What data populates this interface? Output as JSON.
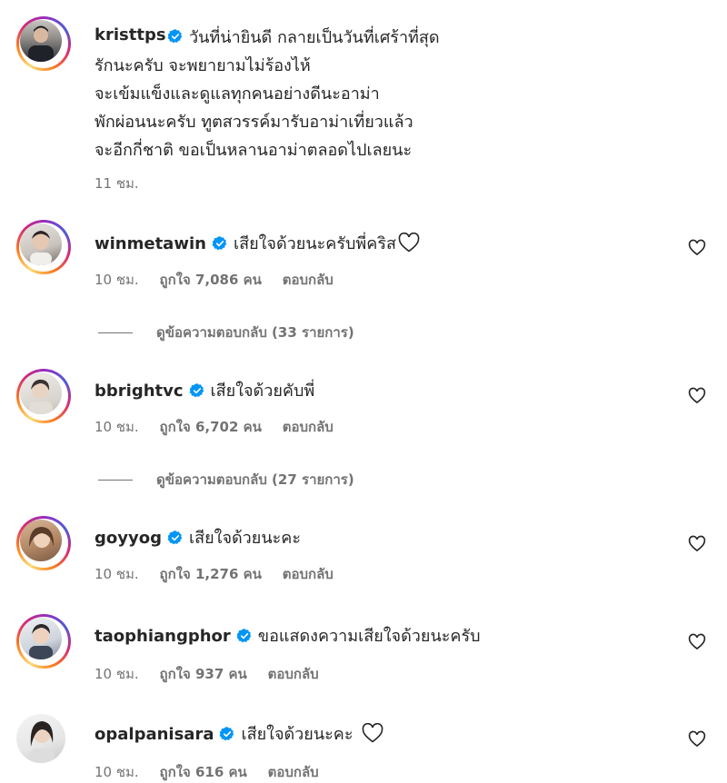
{
  "caption": {
    "username": "kristtps",
    "lines": [
      "วันที่น่ายินดี กลายเป็นวันที่เศร้าที่สุด",
      "รักนะครับ จะพยายามไม่ร้องไห้",
      "จะเข้มแข็งและดูแลทุกคนอย่างดีนะอาม่า",
      "พักผ่อนนะครับ ทูตสวรรค์มารับอาม่าเที่ยวแล้ว",
      "จะอีกกี่ชาติ ขอเป็นหลานอาม่าตลอดไปเลยนะ"
    ],
    "time": "11 ชม."
  },
  "comments": [
    {
      "username": "winmetawin",
      "text": "เสียใจด้วยนะครับพี่คริส",
      "time": "10 ชม.",
      "likes": "ถูกใจ 7,086 คน",
      "reply": "ตอบกลับ",
      "view_replies": "ดูข้อความตอบกลับ (33 รายการ)"
    },
    {
      "username": "bbrightvc",
      "text": "เสียใจด้วยคับพี่",
      "time": "10 ชม.",
      "likes": "ถูกใจ 6,702 คน",
      "reply": "ตอบกลับ",
      "view_replies": "ดูข้อความตอบกลับ (27 รายการ)"
    },
    {
      "username": "goyyog",
      "text": "เสียใจด้วยนะคะ",
      "time": "10 ชม.",
      "likes": "ถูกใจ 1,276 คน",
      "reply": "ตอบกลับ"
    },
    {
      "username": "taophiangphor",
      "text": "ขอแสดงความเสียใจด้วยนะครับ",
      "time": "10 ชม.",
      "likes": "ถูกใจ 937 คน",
      "reply": "ตอบกลับ"
    },
    {
      "username": "opalpanisara",
      "text": "เสียใจด้วยนะคะ",
      "time": "10 ชม.",
      "likes": "ถูกใจ 616 คน",
      "reply": "ตอบกลับ"
    }
  ],
  "colors": {
    "verified": "#0095f6",
    "meta": "#737373",
    "text": "#262626"
  },
  "icons": {
    "like": "heart-outline-icon",
    "verified": "verified-badge-icon",
    "emoji": "white-heart-emoji"
  }
}
